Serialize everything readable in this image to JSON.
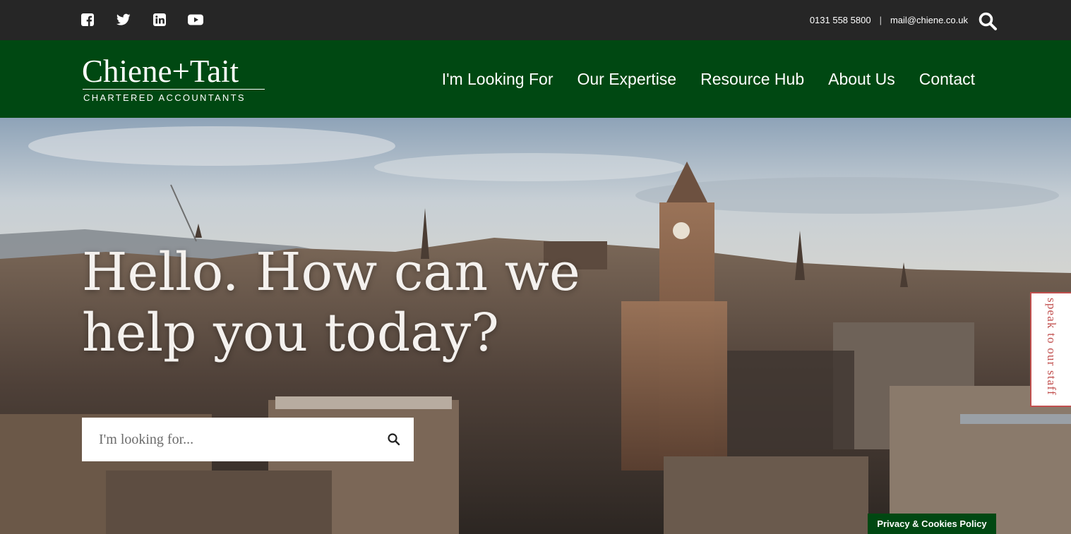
{
  "topbar": {
    "social": [
      {
        "name": "facebook-icon"
      },
      {
        "name": "twitter-icon"
      },
      {
        "name": "linkedin-icon"
      },
      {
        "name": "youtube-icon"
      }
    ],
    "phone": "0131 558 5800",
    "separator": "|",
    "email": "mail@chiene.co.uk",
    "search_icon": "search-icon"
  },
  "header": {
    "logo_name": "Chiene+Tait",
    "logo_sub": "CHARTERED ACCOUNTANTS",
    "nav": [
      {
        "label": "I'm Looking For"
      },
      {
        "label": "Our Expertise"
      },
      {
        "label": "Resource Hub"
      },
      {
        "label": "About Us"
      },
      {
        "label": "Contact"
      }
    ]
  },
  "hero": {
    "headline_line1": "Hello. How can we",
    "headline_line2": "help you today?",
    "search_placeholder": "I'm looking for...",
    "speak_tab": "speak to our staff",
    "privacy": "Privacy & Cookies Policy"
  },
  "colors": {
    "brand_green": "#004812",
    "topbar": "#262626",
    "accent_red": "#c1504f"
  }
}
